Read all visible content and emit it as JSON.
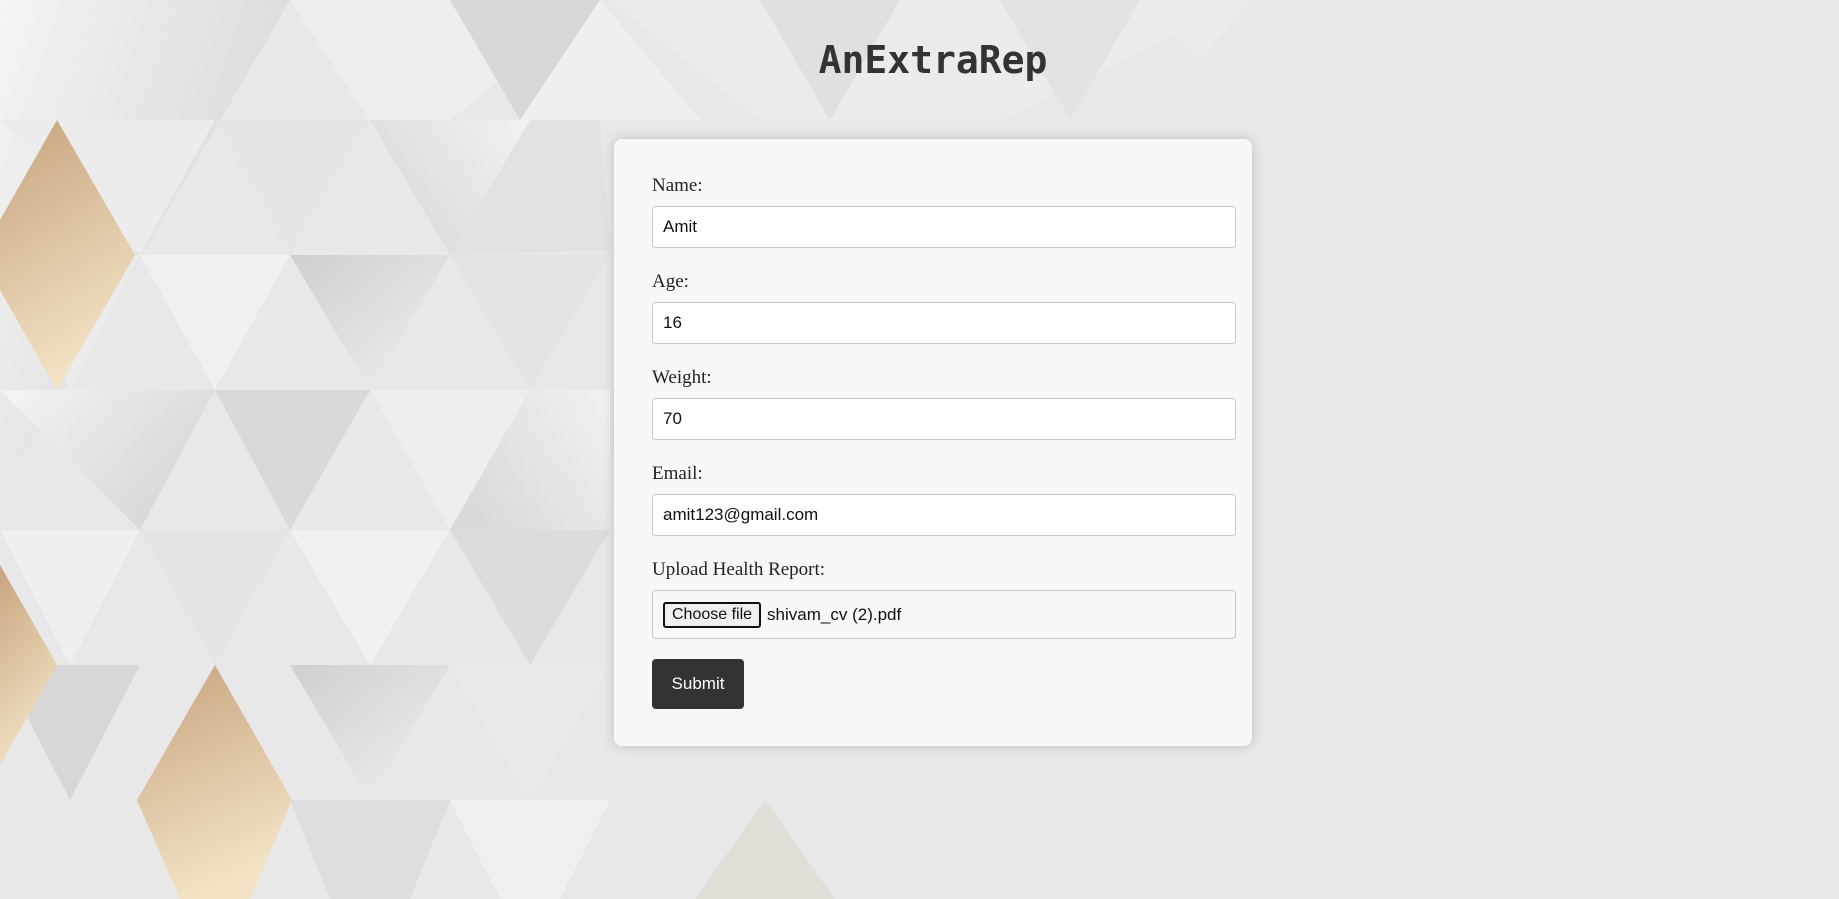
{
  "header": {
    "title": "AnExtraRep"
  },
  "form": {
    "name": {
      "label": "Name:",
      "value": "Amit"
    },
    "age": {
      "label": "Age:",
      "value": "16"
    },
    "weight": {
      "label": "Weight:",
      "value": "70"
    },
    "email": {
      "label": "Email:",
      "value": "amit123@gmail.com"
    },
    "upload": {
      "label": "Upload Health Report:",
      "button_label": "Choose file",
      "file_name": "shivam_cv (2).pdf"
    },
    "submit_label": "Submit"
  },
  "colors": {
    "background": "#e8e8e8",
    "card": "#f8f8f8",
    "title": "#333333",
    "submit_button": "#333333",
    "accent_gold": "#d8b68e"
  }
}
